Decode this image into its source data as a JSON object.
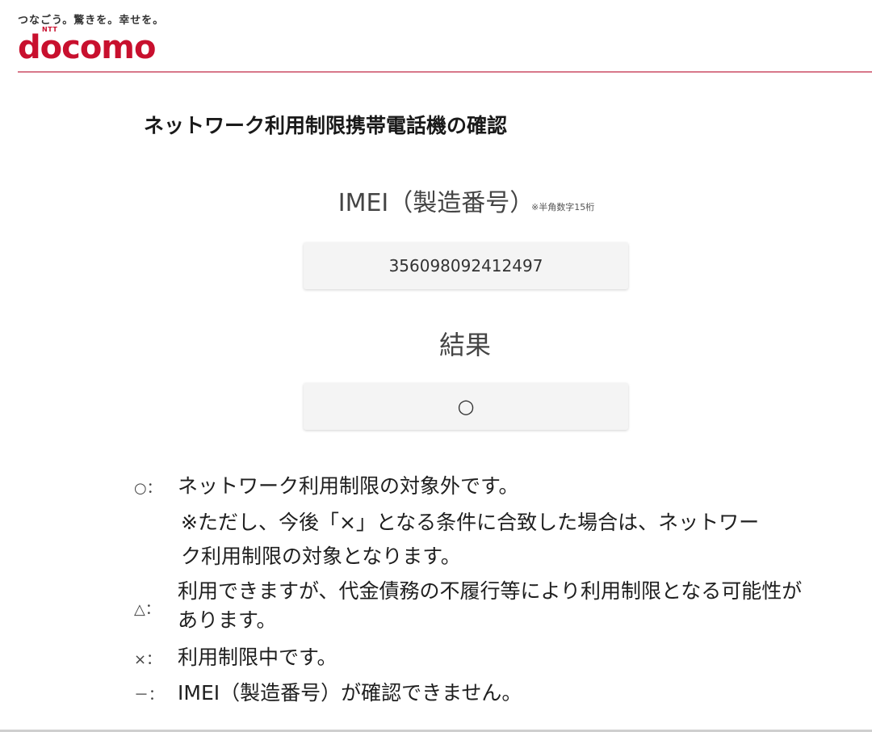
{
  "header": {
    "tagline": "つなごう。驚きを。幸せを。",
    "logo_small": "NTT",
    "logo_word": "docomo",
    "brand_color": "#c8102e"
  },
  "main": {
    "title": "ネットワーク利用制限携帯電話機の確認",
    "imei_label": "IMEI（製造番号）",
    "imei_note": "※半角数字15桁",
    "imei_value": "356098092412497",
    "result_label": "結果",
    "result_value": "○"
  },
  "legend": [
    {
      "symbol": "○：",
      "text": "ネットワーク利用制限の対象外です。",
      "note": "※ただし、今後「×」となる条件に合致した場合は、ネットワーク利用制限の対象となります。"
    },
    {
      "symbol": "△：",
      "text": "利用できますが、代金債務の不履行等により利用制限となる可能性があります。"
    },
    {
      "symbol": "×：",
      "text": "利用制限中です。"
    },
    {
      "symbol": "－：",
      "text": "IMEI（製造番号）が確認できません。"
    }
  ]
}
